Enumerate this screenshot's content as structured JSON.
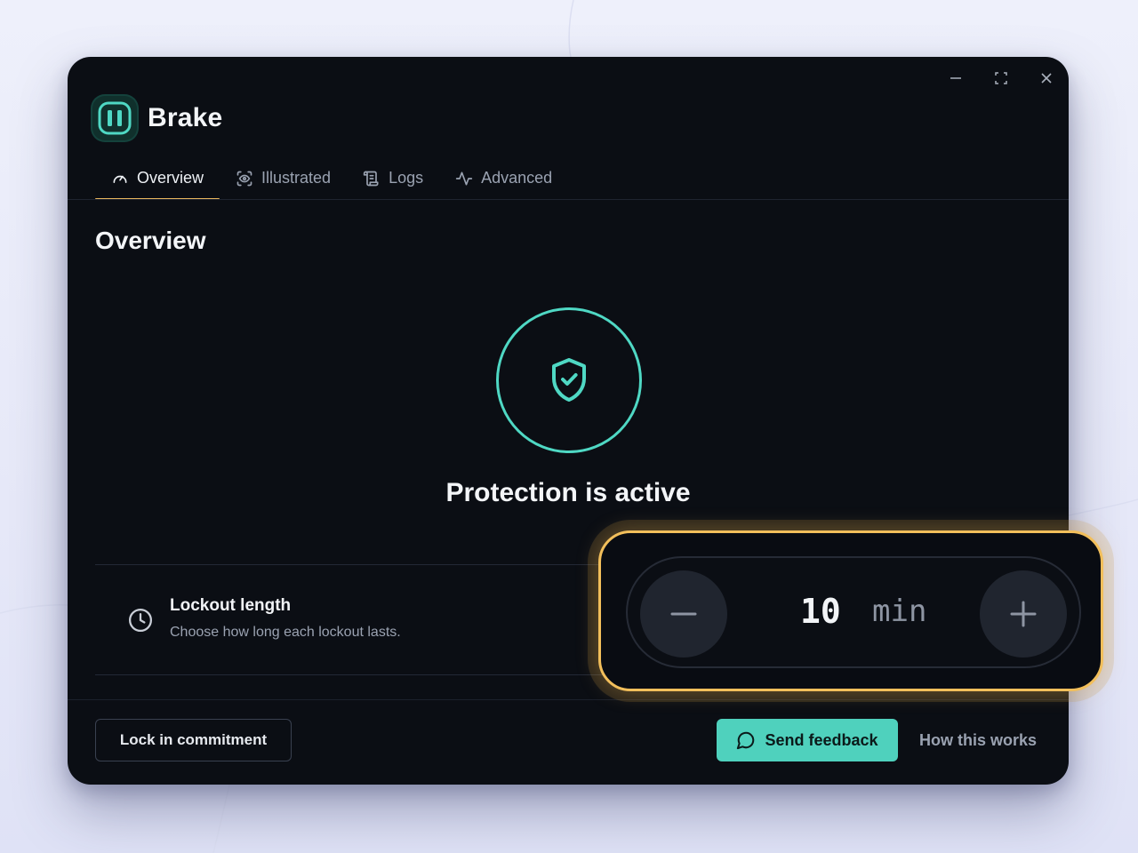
{
  "app": {
    "name": "Brake"
  },
  "tabs": [
    {
      "label": "Overview",
      "icon": "gauge-icon",
      "active": true
    },
    {
      "label": "Illustrated",
      "icon": "scan-eye-icon",
      "active": false
    },
    {
      "label": "Logs",
      "icon": "scroll-icon",
      "active": false
    },
    {
      "label": "Advanced",
      "icon": "activity-icon",
      "active": false
    }
  ],
  "page": {
    "title": "Overview"
  },
  "status": {
    "text": "Protection is active",
    "icon": "shield-check-icon"
  },
  "setting": {
    "title": "Lockout length",
    "description": "Choose how long each lockout lasts.",
    "icon": "clock-icon",
    "value": "10",
    "unit": "min"
  },
  "footer": {
    "lock_label": "Lock in commitment",
    "feedback_label": "Send feedback",
    "how_label": "How this works"
  },
  "colors": {
    "accent": "#4fd1bd",
    "highlight": "#f2bf5b",
    "tab_indicator": "#e9b75e",
    "window_bg": "#0b0e14"
  }
}
